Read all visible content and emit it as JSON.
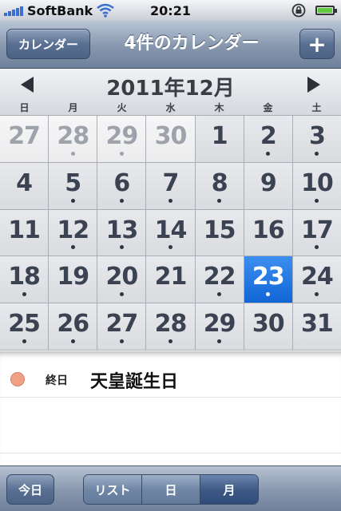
{
  "status_bar": {
    "carrier": "SoftBank",
    "time": "20:21"
  },
  "nav": {
    "left_button": "カレンダー",
    "title": "4件のカレンダー",
    "add_button": "+"
  },
  "month": {
    "title": "2011年12月",
    "weekdays": [
      "日",
      "月",
      "火",
      "水",
      "木",
      "金",
      "土"
    ]
  },
  "calendar": {
    "selected_day": "23",
    "days": [
      {
        "n": "27",
        "out": true,
        "dot": false
      },
      {
        "n": "28",
        "out": true,
        "dot": true
      },
      {
        "n": "29",
        "out": true,
        "dot": true
      },
      {
        "n": "30",
        "out": true,
        "dot": false
      },
      {
        "n": "1",
        "out": false,
        "dot": false
      },
      {
        "n": "2",
        "out": false,
        "dot": true
      },
      {
        "n": "3",
        "out": false,
        "dot": true
      },
      {
        "n": "4",
        "out": false,
        "dot": false
      },
      {
        "n": "5",
        "out": false,
        "dot": true
      },
      {
        "n": "6",
        "out": false,
        "dot": true
      },
      {
        "n": "7",
        "out": false,
        "dot": true
      },
      {
        "n": "8",
        "out": false,
        "dot": true
      },
      {
        "n": "9",
        "out": false,
        "dot": false
      },
      {
        "n": "10",
        "out": false,
        "dot": true
      },
      {
        "n": "11",
        "out": false,
        "dot": false
      },
      {
        "n": "12",
        "out": false,
        "dot": true
      },
      {
        "n": "13",
        "out": false,
        "dot": true
      },
      {
        "n": "14",
        "out": false,
        "dot": true
      },
      {
        "n": "15",
        "out": false,
        "dot": false
      },
      {
        "n": "16",
        "out": false,
        "dot": false
      },
      {
        "n": "17",
        "out": false,
        "dot": true
      },
      {
        "n": "18",
        "out": false,
        "dot": true
      },
      {
        "n": "19",
        "out": false,
        "dot": false
      },
      {
        "n": "20",
        "out": false,
        "dot": true
      },
      {
        "n": "21",
        "out": false,
        "dot": false
      },
      {
        "n": "22",
        "out": false,
        "dot": true
      },
      {
        "n": "23",
        "out": false,
        "dot": true
      },
      {
        "n": "24",
        "out": false,
        "dot": true
      },
      {
        "n": "25",
        "out": false,
        "dot": true
      },
      {
        "n": "26",
        "out": false,
        "dot": true
      },
      {
        "n": "27",
        "out": false,
        "dot": true
      },
      {
        "n": "28",
        "out": false,
        "dot": true
      },
      {
        "n": "29",
        "out": false,
        "dot": true
      },
      {
        "n": "30",
        "out": false,
        "dot": false
      },
      {
        "n": "31",
        "out": false,
        "dot": false
      }
    ]
  },
  "events": [
    {
      "time": "終日",
      "title": "天皇誕生日",
      "color": "#efa085"
    }
  ],
  "toolbar": {
    "today": "今日",
    "segments": [
      "リスト",
      "日",
      "月"
    ],
    "active_segment": "月"
  },
  "colors": {
    "selected": "#1a74e2",
    "nav": "#6f819b"
  }
}
